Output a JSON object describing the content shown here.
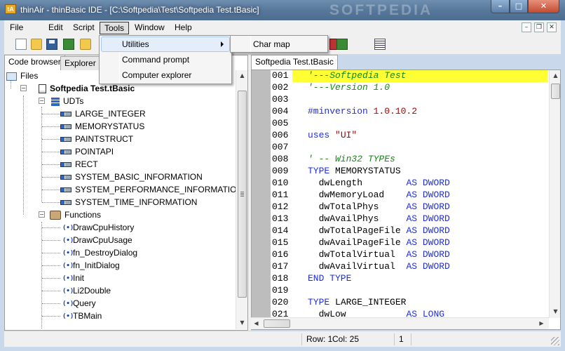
{
  "window": {
    "title": "thinAir - thinBasic IDE - [C:\\Softpedia\\Test\\Softpedia Test.tBasic]",
    "watermark": "SOFTPEDIA",
    "app_icon": "tA",
    "minimize": "–",
    "maximize": "□",
    "close": "✕"
  },
  "menubar": {
    "items": [
      "File",
      "Edit",
      "Script",
      "Tools",
      "Window",
      "Help"
    ],
    "active": "Tools",
    "mdi_minimize": "–",
    "mdi_restore": "❐",
    "mdi_close": "✕"
  },
  "tools_menu": {
    "items": [
      "Utilities",
      "Command prompt",
      "Computer explorer"
    ],
    "highlighted": "Utilities"
  },
  "utilities_submenu": {
    "items": [
      "Char map"
    ]
  },
  "left_panel": {
    "tabs": [
      "Code browser",
      "Explorer"
    ],
    "active_tab": "Code browser",
    "tree": {
      "root": "Files",
      "file": "Softpedia Test.tBasic",
      "udts_label": "UDTs",
      "udts": [
        "LARGE_INTEGER",
        "MEMORYSTATUS",
        "PAINTSTRUCT",
        "POINTAPI",
        "RECT",
        "SYSTEM_BASIC_INFORMATION",
        "SYSTEM_PERFORMANCE_INFORMATION",
        "SYSTEM_TIME_INFORMATION"
      ],
      "functions_label": "Functions",
      "functions": [
        "DrawCpuHistory",
        "DrawCpuUsage",
        "fn_DestroyDialog",
        "fn_InitDialog",
        "Init",
        "Li2Double",
        "Query",
        "TBMain"
      ],
      "func_glyph": "(•)"
    }
  },
  "editor": {
    "tab": "Softpedia Test.tBasic",
    "highlight_color": "#ffff33",
    "lines": [
      {
        "num": "001",
        "parts": [
          {
            "t": "'---Softpedia Test",
            "c": "comment"
          }
        ],
        "highlight": true,
        "indent": 0
      },
      {
        "num": "002",
        "parts": [
          {
            "t": "'---Version 1.0",
            "c": "comment"
          }
        ],
        "indent": 0
      },
      {
        "num": "003",
        "parts": [],
        "indent": 0
      },
      {
        "num": "004",
        "parts": [
          {
            "t": "#minversion ",
            "c": "keyword"
          },
          {
            "t": "1.0.10.2",
            "c": "string"
          }
        ],
        "indent": 0
      },
      {
        "num": "005",
        "parts": [],
        "indent": 0
      },
      {
        "num": "006",
        "parts": [
          {
            "t": "uses ",
            "c": "keyword"
          },
          {
            "t": "\"UI\"",
            "c": "string"
          }
        ],
        "indent": 0
      },
      {
        "num": "007",
        "parts": [],
        "indent": 0
      },
      {
        "num": "008",
        "parts": [
          {
            "t": "' -- Win32 TYPEs",
            "c": "comment"
          }
        ],
        "indent": 0
      },
      {
        "num": "009",
        "parts": [
          {
            "t": "TYPE ",
            "c": "keyword"
          },
          {
            "t": "MEMORYSTATUS",
            "c": "plain"
          }
        ],
        "indent": 0
      },
      {
        "num": "010",
        "parts": [
          {
            "t": "  dwLength        ",
            "c": "plain"
          },
          {
            "t": "AS DWORD",
            "c": "keyword"
          }
        ],
        "indent": 0
      },
      {
        "num": "011",
        "parts": [
          {
            "t": "  dwMemoryLoad    ",
            "c": "plain"
          },
          {
            "t": "AS DWORD",
            "c": "keyword"
          }
        ],
        "indent": 0
      },
      {
        "num": "012",
        "parts": [
          {
            "t": "  dwTotalPhys     ",
            "c": "plain"
          },
          {
            "t": "AS DWORD",
            "c": "keyword"
          }
        ],
        "indent": 0
      },
      {
        "num": "013",
        "parts": [
          {
            "t": "  dwAvailPhys     ",
            "c": "plain"
          },
          {
            "t": "AS DWORD",
            "c": "keyword"
          }
        ],
        "indent": 0
      },
      {
        "num": "014",
        "parts": [
          {
            "t": "  dwTotalPageFile ",
            "c": "plain"
          },
          {
            "t": "AS DWORD",
            "c": "keyword"
          }
        ],
        "indent": 0
      },
      {
        "num": "015",
        "parts": [
          {
            "t": "  dwAvailPageFile ",
            "c": "plain"
          },
          {
            "t": "AS DWORD",
            "c": "keyword"
          }
        ],
        "indent": 0
      },
      {
        "num": "016",
        "parts": [
          {
            "t": "  dwTotalVirtual  ",
            "c": "plain"
          },
          {
            "t": "AS DWORD",
            "c": "keyword"
          }
        ],
        "indent": 0
      },
      {
        "num": "017",
        "parts": [
          {
            "t": "  dwAvailVirtual  ",
            "c": "plain"
          },
          {
            "t": "AS DWORD",
            "c": "keyword"
          }
        ],
        "indent": 0
      },
      {
        "num": "018",
        "parts": [
          {
            "t": "END TYPE",
            "c": "keyword"
          }
        ],
        "indent": 0
      },
      {
        "num": "019",
        "parts": [],
        "indent": 0
      },
      {
        "num": "020",
        "parts": [
          {
            "t": "TYPE ",
            "c": "keyword"
          },
          {
            "t": "LARGE_INTEGER",
            "c": "plain"
          }
        ],
        "indent": 0
      },
      {
        "num": "021",
        "parts": [
          {
            "t": "  dwLow           ",
            "c": "plain"
          },
          {
            "t": "AS LONG",
            "c": "keyword"
          }
        ],
        "indent": 0
      }
    ]
  },
  "statusbar": {
    "row": "Row: 1",
    "col": "Col: 25",
    "extra": "1"
  },
  "scroll": {
    "up": "▲",
    "down": "▼",
    "left": "◀",
    "right": "▶"
  }
}
